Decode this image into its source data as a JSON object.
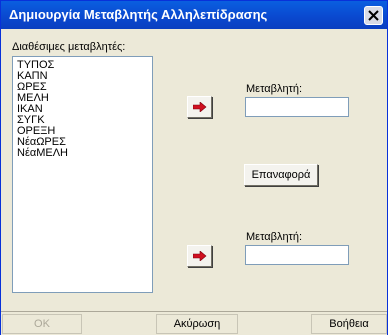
{
  "window": {
    "title": "Δημιουργία Μεταβλητής Αλληλεπίδρασης"
  },
  "left": {
    "label": "Διαθέσιμες μεταβλητές:",
    "items": [
      "ΤΥΠΟΣ",
      "ΚΑΠΝ",
      "ΩΡΕΣ",
      "ΜΕΛΗ",
      "ΙΚΑΝ",
      "ΣΥΓΚ",
      "ΟΡΕΞΗ",
      "ΝέαΩΡΕΣ",
      "ΝέαΜΕΛΗ"
    ]
  },
  "var1": {
    "label": "Μεταβλητή:",
    "value": ""
  },
  "var2": {
    "label": "Μεταβλητή:",
    "value": ""
  },
  "reset_button": "Επαναφορά",
  "bottom": {
    "ok": "OK",
    "cancel": "Ακύρωση",
    "help": "Βοήθεια"
  },
  "colors": {
    "arrow": "#d01020",
    "titlebar": "#0a4fd6"
  },
  "icons": {
    "close": "close-icon",
    "arrow": "arrow-right-icon"
  }
}
